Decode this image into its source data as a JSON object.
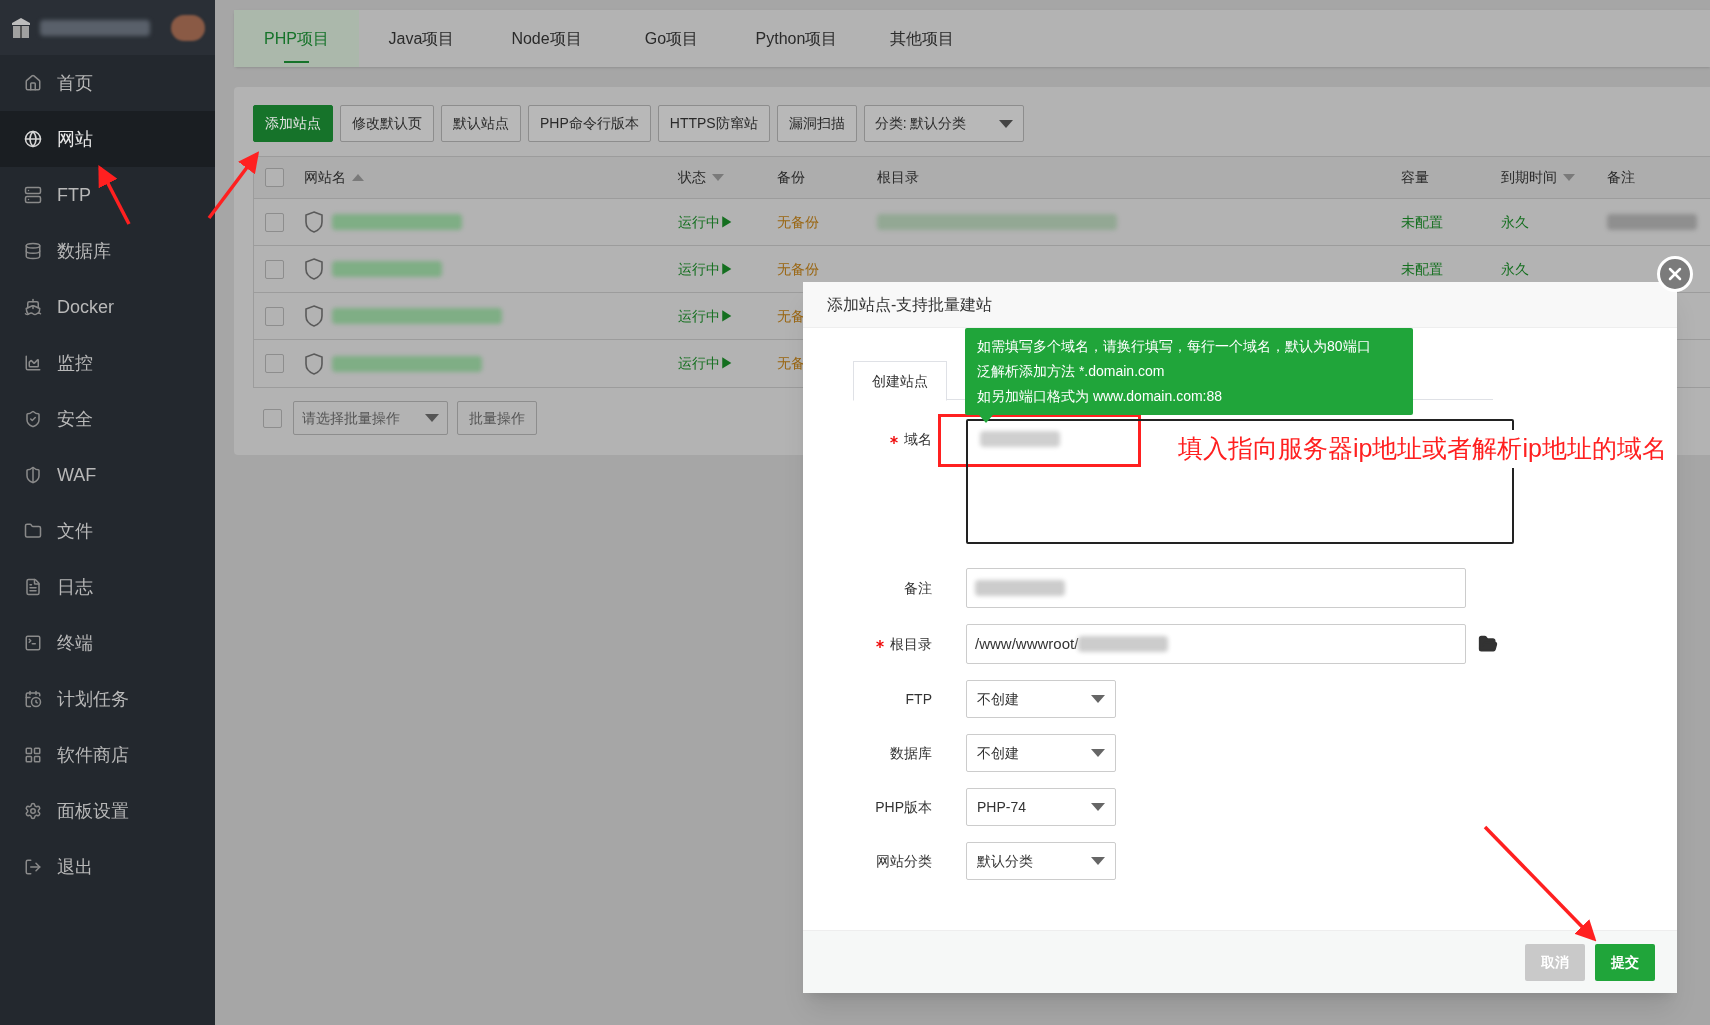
{
  "sidebar": {
    "items": [
      {
        "label": "首页",
        "selected": false
      },
      {
        "label": "网站",
        "selected": true
      },
      {
        "label": "FTP",
        "selected": false
      },
      {
        "label": "数据库",
        "selected": false
      },
      {
        "label": "Docker",
        "selected": false
      },
      {
        "label": "监控",
        "selected": false
      },
      {
        "label": "安全",
        "selected": false
      },
      {
        "label": "WAF",
        "selected": false
      },
      {
        "label": "文件",
        "selected": false
      },
      {
        "label": "日志",
        "selected": false
      },
      {
        "label": "终端",
        "selected": false
      },
      {
        "label": "计划任务",
        "selected": false
      },
      {
        "label": "软件商店",
        "selected": false
      },
      {
        "label": "面板设置",
        "selected": false
      },
      {
        "label": "退出",
        "selected": false
      }
    ]
  },
  "tabs": [
    {
      "label": "PHP项目",
      "selected": true
    },
    {
      "label": "Java项目",
      "selected": false
    },
    {
      "label": "Node项目",
      "selected": false
    },
    {
      "label": "Go项目",
      "selected": false
    },
    {
      "label": "Python项目",
      "selected": false
    },
    {
      "label": "其他项目",
      "selected": false
    }
  ],
  "toolbar": {
    "buttons": [
      {
        "label": "添加站点",
        "kind": "primary"
      },
      {
        "label": "修改默认页",
        "kind": "default"
      },
      {
        "label": "默认站点",
        "kind": "default"
      },
      {
        "label": "PHP命令行版本",
        "kind": "default"
      },
      {
        "label": "HTTPS防窜站",
        "kind": "default"
      },
      {
        "label": "漏洞扫描",
        "kind": "default"
      }
    ],
    "category_select": "分类: 默认分类"
  },
  "table": {
    "header_checked": false,
    "columns": [
      {
        "label": "网站名",
        "sort_ascending": true
      },
      {
        "label": "状态",
        "sort_ascending": false
      },
      {
        "label": "备份"
      },
      {
        "label": "根目录"
      },
      {
        "label": "容量"
      },
      {
        "label": "到期时间",
        "sort_ascending": false
      },
      {
        "label": "备注"
      }
    ],
    "rows": [
      {
        "checked": false,
        "status": "运行中▶",
        "backup": "无备份",
        "capacity": "未配置",
        "expiry": "永久"
      },
      {
        "checked": false,
        "status": "运行中▶",
        "backup": "无备份",
        "capacity": "未配置",
        "expiry": "永久"
      },
      {
        "checked": false,
        "status": "运行中▶",
        "backup": "无备"
      },
      {
        "checked": false,
        "status": "运行中▶",
        "backup": "无备"
      }
    ]
  },
  "batch": {
    "checked": false,
    "placeholder": "请选择批量操作",
    "button": "批量操作"
  },
  "modal": {
    "title": "添加站点-支持批量建站",
    "tabs": [
      {
        "label": "创建站点",
        "selected": true
      }
    ],
    "tooltip": [
      "如需填写多个域名，请换行填写，每行一个域名，默认为80端口",
      "泛解析添加方法 *.domain.com",
      "如另加端口格式为 www.domain.com:88"
    ],
    "fields": [
      {
        "kind": "textarea",
        "label": "域名",
        "required": true
      },
      {
        "kind": "input",
        "label": "备注",
        "required": false
      },
      {
        "kind": "path",
        "label": "根目录",
        "required": true,
        "value": "/www/wwwroot/"
      },
      {
        "kind": "select",
        "label": "FTP",
        "required": false,
        "value": "不创建"
      },
      {
        "kind": "select",
        "label": "数据库",
        "required": false,
        "value": "不创建"
      },
      {
        "kind": "select",
        "label": "PHP版本",
        "required": false,
        "value": "PHP-74"
      },
      {
        "kind": "select",
        "label": "网站分类",
        "required": false,
        "value": "默认分类"
      }
    ],
    "buttons": [
      {
        "label": "取消",
        "kind": "cancel"
      },
      {
        "label": "提交",
        "kind": "primary"
      }
    ]
  },
  "annotation": {
    "text": "填入指向服务器ip地址或者解析ip地址的域名"
  }
}
